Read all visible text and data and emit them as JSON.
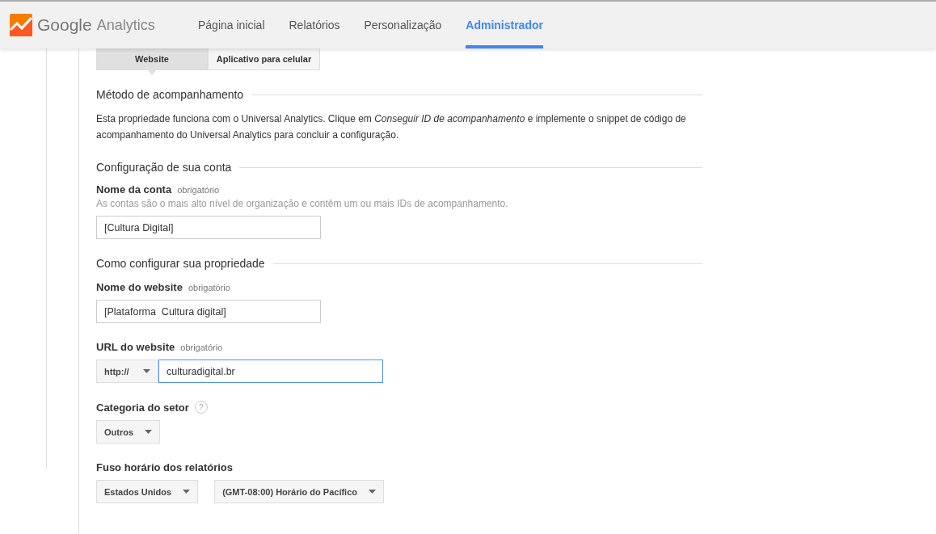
{
  "header": {
    "logo": {
      "brand": "Google",
      "product": "Analytics"
    },
    "nav": [
      {
        "label": "Página inicial",
        "selected": false
      },
      {
        "label": "Relatórios",
        "selected": false
      },
      {
        "label": "Personalização",
        "selected": false
      },
      {
        "label": "Administrador",
        "selected": true
      }
    ]
  },
  "tabs": [
    {
      "label": "Website",
      "selected": true
    },
    {
      "label": "Aplicativo para celular",
      "selected": false
    }
  ],
  "sections": [
    {
      "title": "Método de acompanhamento",
      "fields": [
        {
          "kind": "paragraph",
          "text": "Esta propriedade funciona com o Universal Analytics. Clique em *Conseguir ID de acompanhamento* e implemente o snippet de código de acompanhamento do Universal Analytics para concluir a configuração."
        }
      ]
    },
    {
      "title": "Configuração de sua conta",
      "fields": [
        {
          "kind": "text",
          "label": "Nome da conta",
          "required": "obrigatório",
          "hint": "As contas são o mais alto nível de organização e contêm um ou mais IDs de acompanhamento.",
          "value": "[Cultura Digital]"
        }
      ]
    },
    {
      "title": "Como configurar sua propriedade",
      "fields": [
        {
          "kind": "text",
          "label": "Nome do website",
          "required": "obrigatório",
          "value": "[Plataforma  Cultura digital]"
        },
        {
          "kind": "url",
          "label": "URL do website",
          "required": "obrigatório",
          "protocol": "http://",
          "value": "culturadigital.br",
          "focused": true
        },
        {
          "kind": "select",
          "label": "Categoria do setor",
          "help_icon": "?",
          "options": [
            "Outros"
          ]
        },
        {
          "kind": "select",
          "label": "Fuso horário dos relatórios",
          "options": [
            "Estados Unidos",
            "(GMT-08:00) Horário do Pacífico"
          ]
        }
      ]
    }
  ]
}
